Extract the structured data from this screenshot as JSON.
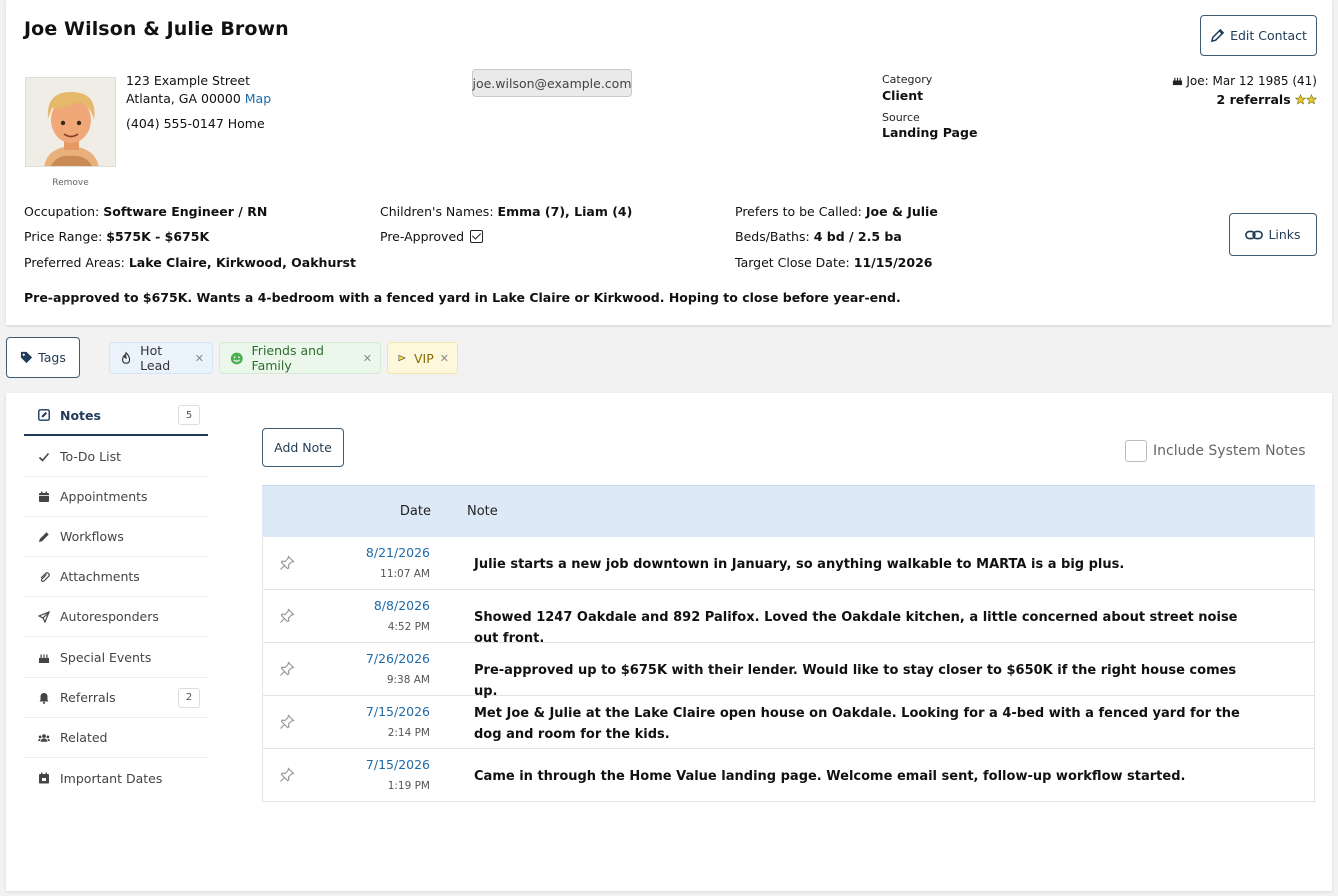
{
  "contact": {
    "name": "Joe Wilson & Julie Brown",
    "edit_label": "Edit Contact",
    "remove_label": "Remove",
    "address_line1": "123 Example Street",
    "address_line2": "Atlanta, GA 00000",
    "map_label": "Map",
    "phone": "(404) 555-0147 Home",
    "email": "joe.wilson@example.com",
    "category_label": "Category",
    "category_value": "Client",
    "source_label": "Source",
    "source_value": "Landing Page",
    "birthday": "Joe: Mar 12 1985 (41)",
    "referrals": "2 referrals",
    "links_label": "Links"
  },
  "fields": {
    "occupation_label": "Occupation:",
    "occupation_value": "Software Engineer / RN",
    "price_label": "Price Range:",
    "price_value": "$575K - $675K",
    "areas_label": "Preferred Areas:",
    "areas_value": "Lake Claire, Kirkwood, Oakhurst",
    "children_label": "Children's Names:",
    "children_value": "Emma (7), Liam (4)",
    "preapproved_label": "Pre-Approved",
    "called_label": "Prefers to be Called:",
    "called_value": "Joe & Julie",
    "beds_label": "Beds/Baths:",
    "beds_value": "4 bd / 2.5 ba",
    "close_label": "Target Close Date:",
    "close_value": "11/15/2026"
  },
  "summary": "Pre-approved to $675K. Wants a 4-bedroom with a fenced yard in Lake Claire or Kirkwood. Hoping to close before year-end.",
  "tags": {
    "button_label": "Tags",
    "items": [
      {
        "label": "Hot Lead",
        "icon": "flame-icon"
      },
      {
        "label": "Friends and Family",
        "icon": "smile-icon"
      },
      {
        "label": "VIP",
        "icon": "flag-icon"
      }
    ]
  },
  "sidebar": {
    "items": [
      {
        "label": "Notes",
        "badge": "5",
        "icon": "edit-icon"
      },
      {
        "label": "To-Do List",
        "icon": "check-icon"
      },
      {
        "label": "Appointments",
        "icon": "calendar-icon"
      },
      {
        "label": "Workflows",
        "icon": "pencil-icon"
      },
      {
        "label": "Attachments",
        "icon": "paperclip-icon"
      },
      {
        "label": "Autoresponders",
        "icon": "send-icon"
      },
      {
        "label": "Special Events",
        "icon": "cake-icon"
      },
      {
        "label": "Referrals",
        "badge": "2",
        "icon": "bell-icon"
      },
      {
        "label": "Related",
        "icon": "users-icon"
      },
      {
        "label": "Important Dates",
        "icon": "calendar-star-icon"
      }
    ]
  },
  "notes": {
    "add_label": "Add Note",
    "system_notes_label": "Include System Notes",
    "col_date": "Date",
    "col_note": "Note",
    "rows": [
      {
        "date": "8/21/2026",
        "time": "11:07 AM",
        "text": "Julie starts a new job downtown in January, so anything walkable to MARTA is a big plus."
      },
      {
        "date": "8/8/2026",
        "time": "4:52 PM",
        "text": "Showed 1247 Oakdale and 892 Palifox. Loved the Oakdale kitchen, a little concerned about street noise out front."
      },
      {
        "date": "7/26/2026",
        "time": "9:38 AM",
        "text": "Pre-approved up to $675K with their lender. Would like to stay closer to $650K if the right house comes up."
      },
      {
        "date": "7/15/2026",
        "time": "2:14 PM",
        "text": "Met Joe & Julie at the Lake Claire open house on Oakdale. Looking for a 4-bed with a fenced yard for the dog and room for the kids."
      },
      {
        "date": "7/15/2026",
        "time": "1:19 PM",
        "text": "Came in through the Home Value landing page. Welcome email sent, follow-up workflow started."
      }
    ]
  }
}
